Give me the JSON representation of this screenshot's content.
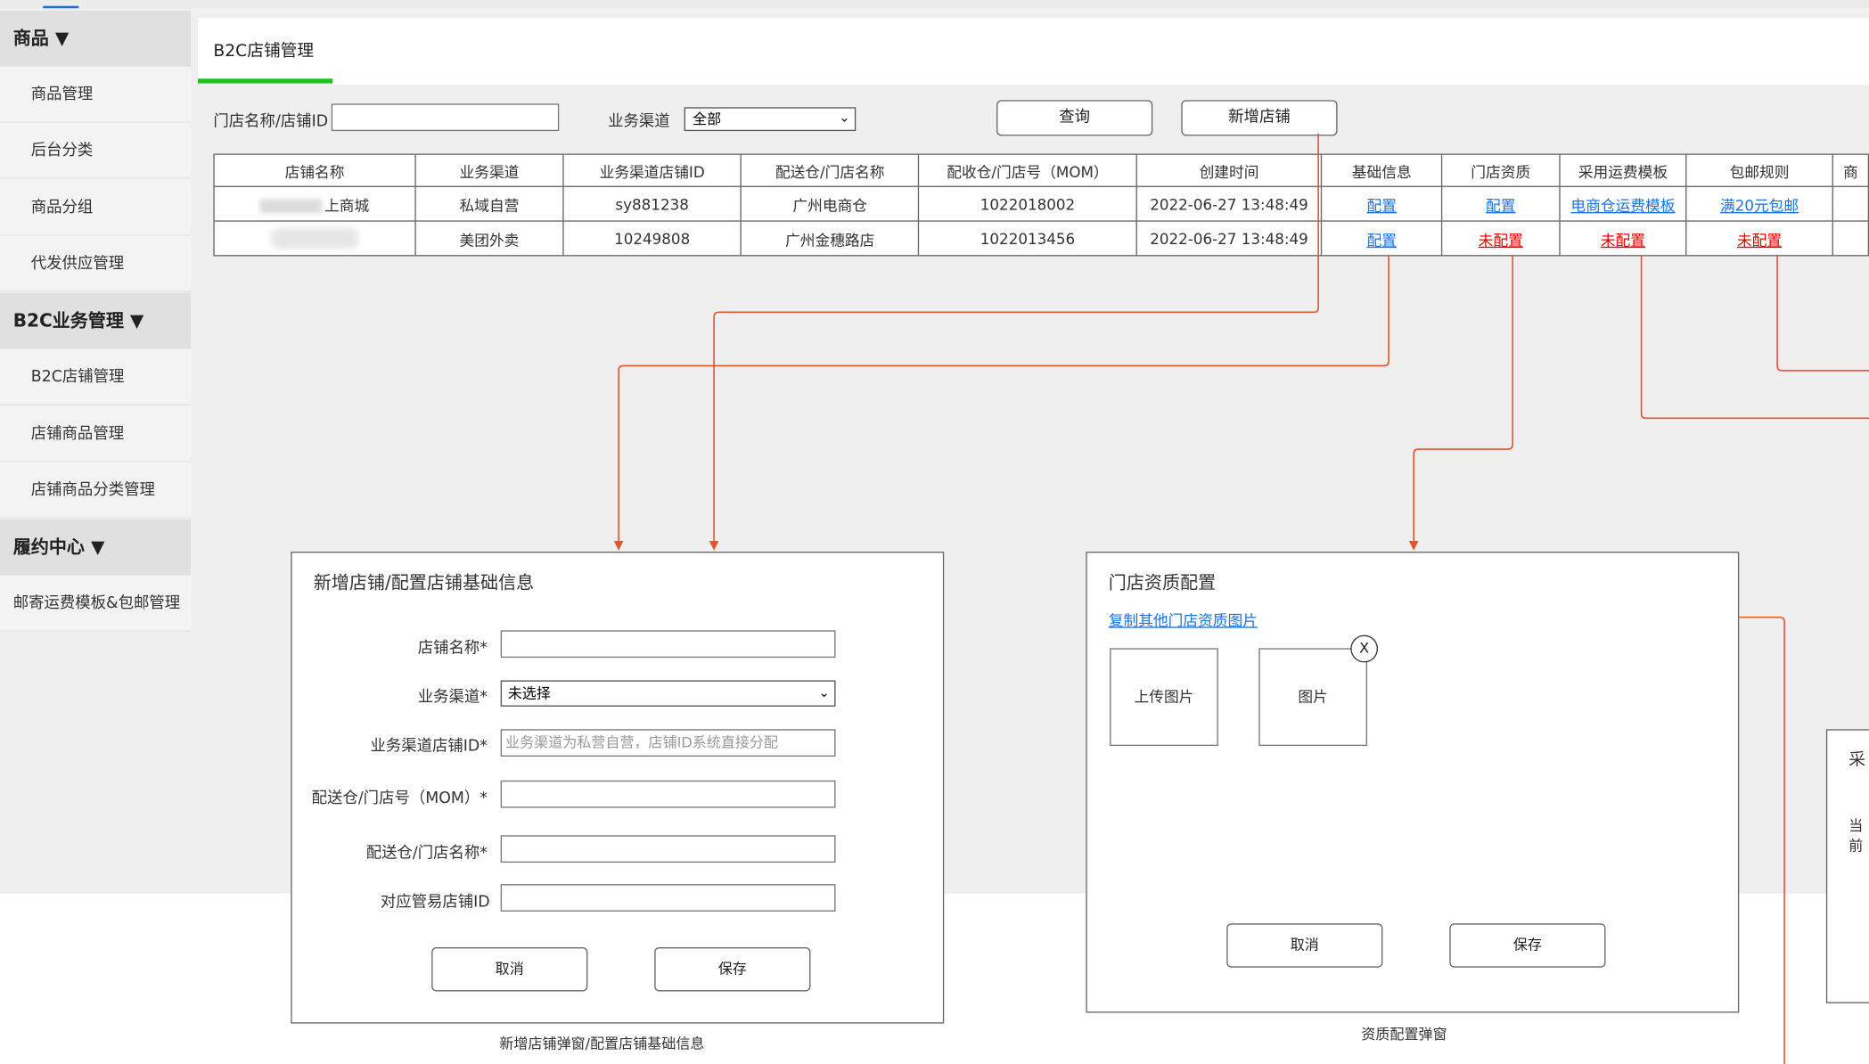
{
  "sidebar": {
    "groups": [
      {
        "label": "商品 ▼",
        "items": [
          "商品管理",
          "后台分类",
          "商品分组",
          "代发供应管理"
        ]
      },
      {
        "label": "B2C业务管理 ▼",
        "items": [
          "B2C店铺管理",
          "店铺商品管理",
          "店铺商品分类管理"
        ]
      },
      {
        "label": "履约中心 ▼",
        "items": [
          "邮寄运费模板&包邮管理"
        ]
      }
    ]
  },
  "tab": {
    "label": "B2C店铺管理"
  },
  "filters": {
    "store_label": "门店名称/店铺ID",
    "store_value": "",
    "channel_label": "业务渠道",
    "channel_value": "全部",
    "query_button": "查询",
    "add_button": "新增店铺"
  },
  "table": {
    "headers": [
      "店铺名称",
      "业务渠道",
      "业务渠道店铺ID",
      "配送仓/门店名称",
      "配收仓/门店号（MOM）",
      "创建时间",
      "基础信息",
      "门店资质",
      "采用运费模板",
      "包邮规则",
      "商"
    ],
    "rows": [
      {
        "name": "上商城",
        "channel": "私域自营",
        "channel_id": "sy881238",
        "warehouse": "广州电商仓",
        "mom": "1022018002",
        "created": "2022-06-27 13:48:49",
        "basic": "配置",
        "qual": "配置",
        "template": "电商仓运费模板",
        "shipping": "满20元包邮"
      },
      {
        "name": "",
        "channel": "美团外卖",
        "channel_id": "10249808",
        "warehouse": "广州金穗路店",
        "mom": "1022013456",
        "created": "2022-06-27 13:48:49",
        "basic": "配置",
        "qual": "未配置",
        "template": "未配置",
        "shipping": "未配置"
      }
    ]
  },
  "dialog_basic": {
    "title": "新增店铺/配置店铺基础信息",
    "fields": [
      {
        "label": "店铺名称*",
        "value": ""
      },
      {
        "label": "业务渠道*",
        "value": "未选择"
      },
      {
        "label": "业务渠道店铺ID*",
        "placeholder": "业务渠道为私营自营，店铺ID系统直接分配"
      },
      {
        "label": "配送仓/门店号（MOM）*",
        "value": ""
      },
      {
        "label": "配送仓/门店名称*",
        "value": ""
      },
      {
        "label": "对应管易店铺ID",
        "value": ""
      }
    ],
    "cancel": "取消",
    "save": "保存",
    "caption": "新增店铺弹窗/配置店铺基础信息"
  },
  "dialog_qual": {
    "title": "门店资质配置",
    "copy_link": "复制其他门店资质图片",
    "upload": "上传图片",
    "image": "图片",
    "close": "X",
    "cancel": "取消",
    "save": "保存",
    "caption": "资质配置弹窗"
  },
  "dialog_partial": {
    "title": "采",
    "line": "当前"
  },
  "colors": {
    "accent_green": "#20c020",
    "link_blue": "#1a73e8",
    "unconfigured_red": "#e00000",
    "connector_orange": "#e8542a"
  }
}
